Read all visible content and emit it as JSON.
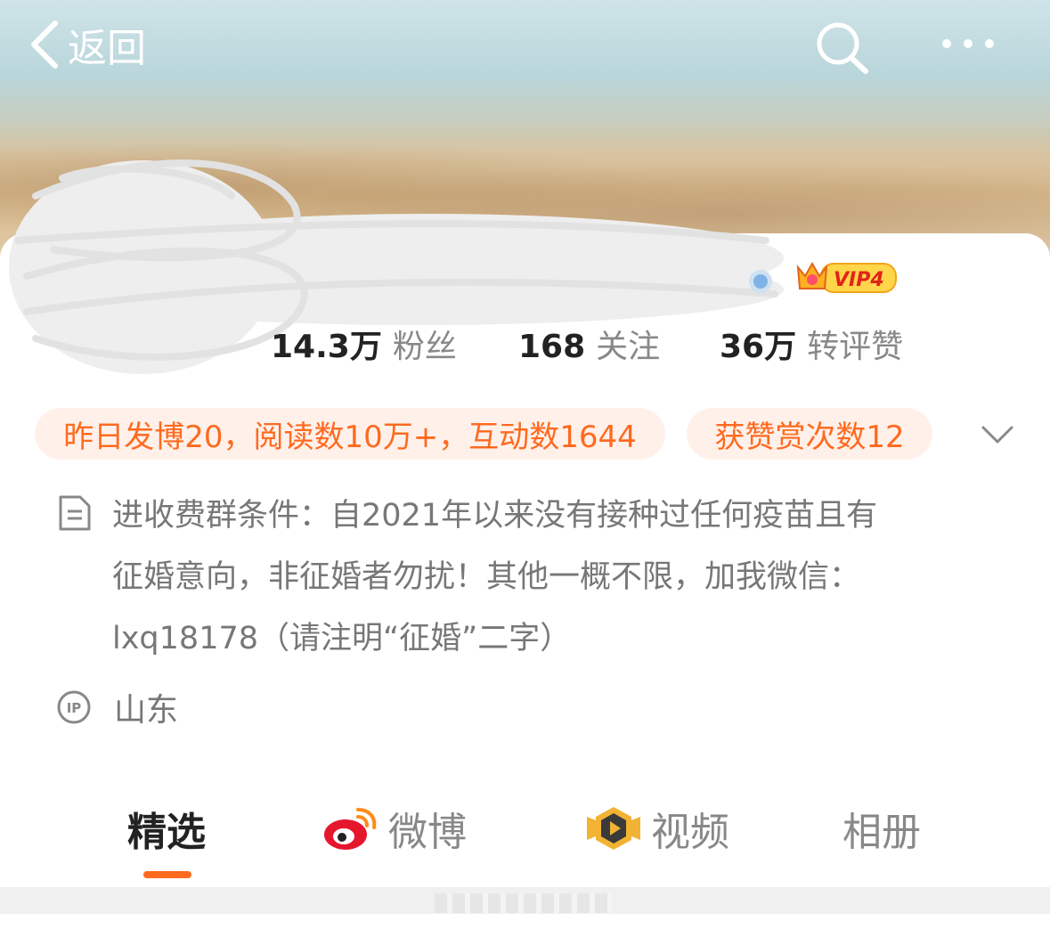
{
  "topbar": {
    "back_label": "返回"
  },
  "profile": {
    "badge": "VIP4",
    "stats": [
      {
        "num": "14.3万",
        "label": "粉丝"
      },
      {
        "num": "168",
        "label": "关注"
      },
      {
        "num": "36万",
        "label": "转评赞"
      }
    ]
  },
  "pills": [
    "昨日发博20，阅读数10万+，互动数1644",
    "获赞赏次数12"
  ],
  "description": {
    "line1": "进收费群条件：自2021年以来没有接种过任何疫苗且有",
    "line2": "征婚意向，非征婚者勿扰！其他一概不限，加我微信：",
    "line3": "lxq18178（请注明“征婚”二字）"
  },
  "ip_location": "山东",
  "tabs": [
    {
      "label": "精选",
      "active": true
    },
    {
      "label": "微博",
      "icon": "weibo-icon"
    },
    {
      "label": "视频",
      "icon": "video-icon"
    },
    {
      "label": "相册"
    }
  ],
  "colors": {
    "accent": "#ff6a1f",
    "pill_bg": "#fff1ea",
    "text_primary": "#222222",
    "text_secondary": "#777777"
  }
}
